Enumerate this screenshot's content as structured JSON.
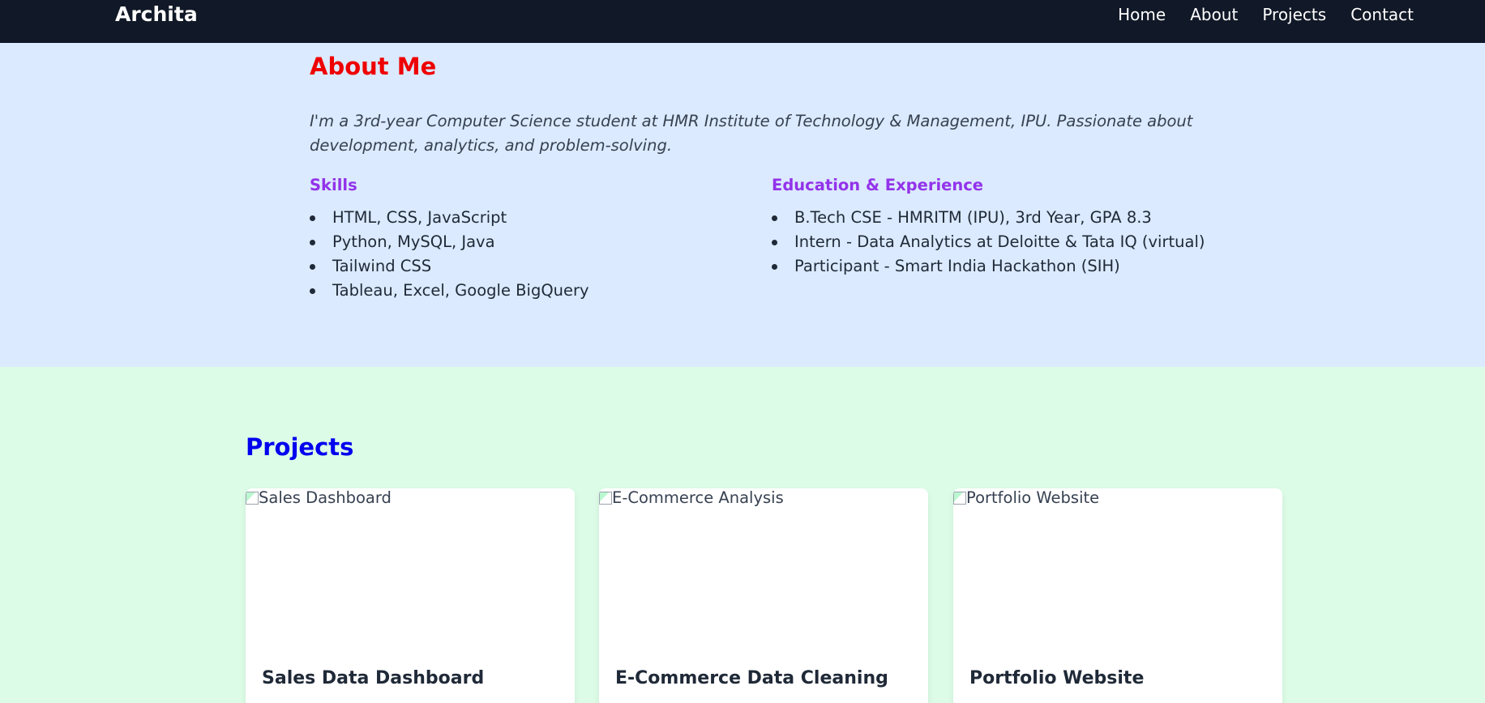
{
  "nav": {
    "brand": "Archita",
    "links": [
      "Home",
      "About",
      "Projects",
      "Contact"
    ]
  },
  "about": {
    "title": "About Me",
    "intro": "I'm a 3rd-year Computer Science student at HMR Institute of Technology & Management, IPU. Passionate about development, analytics, and problem-solving.",
    "skills": {
      "title": "Skills",
      "items": [
        "HTML, CSS, JavaScript",
        "Python, MySQL, Java",
        "Tailwind CSS",
        "Tableau, Excel, Google BigQuery"
      ]
    },
    "education": {
      "title": "Education & Experience",
      "items": [
        "B.Tech CSE - HMRITM (IPU), 3rd Year, GPA 8.3",
        "Intern - Data Analytics at Deloitte & Tata IQ (virtual)",
        "Participant - Smart India Hackathon (SIH)"
      ]
    }
  },
  "projects": {
    "title": "Projects",
    "cards": [
      {
        "img_alt": "Sales Dashboard",
        "title": "Sales Data Dashboard"
      },
      {
        "img_alt": "E-Commerce Analysis",
        "title": "E-Commerce Data Cleaning"
      },
      {
        "img_alt": "Portfolio Website",
        "title": "Portfolio Website"
      }
    ]
  },
  "colors": {
    "navbar": "#111827",
    "about_bg": "#dbeafe",
    "projects_bg": "#dcfce7",
    "about_title": "#ef0000",
    "section_subtitle": "#9333ea",
    "projects_title": "#0000ee"
  }
}
